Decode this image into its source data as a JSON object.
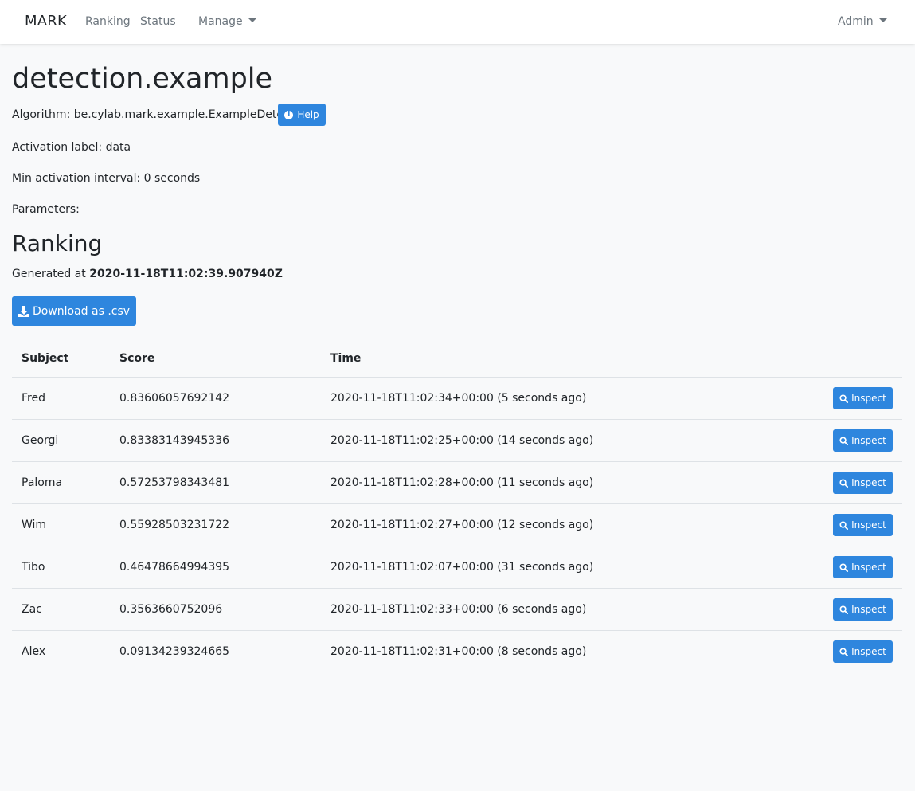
{
  "navbar": {
    "brand": "MARK",
    "links": [
      "Ranking",
      "Status"
    ],
    "manage_label": "Manage",
    "admin_label": "Admin"
  },
  "detector": {
    "title": "detection.example",
    "algorithm_label": "Algorithm:",
    "algorithm_value": "be.cylab.mark.example.ExampleDetector",
    "help_label": "Help",
    "activation_label_text": "Activation label:",
    "activation_label_value": "data",
    "min_interval_text": "Min activation interval:",
    "min_interval_value": "0 seconds",
    "parameters_label": "Parameters:"
  },
  "ranking": {
    "title": "Ranking",
    "generated_prefix": "Generated at",
    "generated_at": "2020-11-18T11:02:39.907940Z",
    "download_label": "Download as .csv",
    "columns": [
      "Subject",
      "Score",
      "Time"
    ],
    "rows": [
      {
        "subject": "Fred",
        "score": "0.83606057692142",
        "time": "2020-11-18T11:02:34+00:00 (5 seconds ago)",
        "action": "Inspect"
      },
      {
        "subject": "Georgi",
        "score": "0.83383143945336",
        "time": "2020-11-18T11:02:25+00:00 (14 seconds ago)",
        "action": "Inspect"
      },
      {
        "subject": "Paloma",
        "score": "0.57253798343481",
        "time": "2020-11-18T11:02:28+00:00 (11 seconds ago)",
        "action": "Inspect"
      },
      {
        "subject": "Wim",
        "score": "0.55928503231722",
        "time": "2020-11-18T11:02:27+00:00 (12 seconds ago)",
        "action": "Inspect"
      },
      {
        "subject": "Tibo",
        "score": "0.46478664994395",
        "time": "2020-11-18T11:02:07+00:00 (31 seconds ago)",
        "action": "Inspect"
      },
      {
        "subject": "Zac",
        "score": "0.3563660752096",
        "time": "2020-11-18T11:02:33+00:00 (6 seconds ago)",
        "action": "Inspect"
      },
      {
        "subject": "Alex",
        "score": "0.09134239324665",
        "time": "2020-11-18T11:02:31+00:00 (8 seconds ago)",
        "action": "Inspect"
      }
    ]
  },
  "colors": {
    "accent": "#2e86de",
    "page_background": "#f8f9fa",
    "navbar_background": "#ffffff",
    "muted_text": "#6c757d"
  },
  "icons": {
    "help": "info-circle-icon",
    "download": "download-icon",
    "inspect": "search-icon",
    "dropdown": "caret-down-icon"
  }
}
